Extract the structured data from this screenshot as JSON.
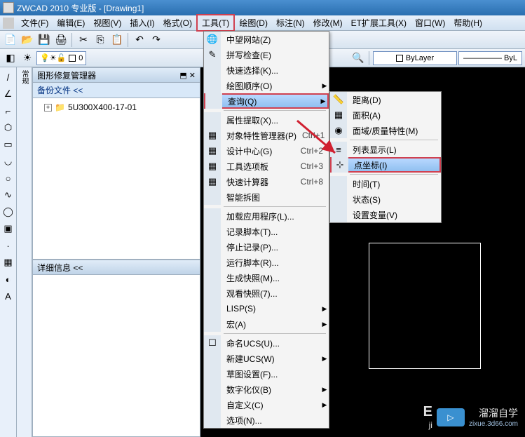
{
  "title": "ZWCAD 2010 专业版 - [Drawing1]",
  "menubar": {
    "items": [
      {
        "label": "文件(F)"
      },
      {
        "label": "编辑(E)"
      },
      {
        "label": "视图(V)"
      },
      {
        "label": "插入(I)"
      },
      {
        "label": "格式(O)"
      },
      {
        "label": "工具(T)",
        "active": true
      },
      {
        "label": "绘图(D)"
      },
      {
        "label": "标注(N)"
      },
      {
        "label": "修改(M)"
      },
      {
        "label": "ET扩展工具(X)"
      },
      {
        "label": "窗口(W)"
      },
      {
        "label": "帮助(H)"
      }
    ]
  },
  "toolbar1": {
    "zero": "0",
    "bylayer": "ByLayer",
    "bylayer2": "ByL"
  },
  "panel1": {
    "title": "图形修复管理器",
    "sub": "备份文件 <<",
    "tree_item": "5U300X400-17-01"
  },
  "panel2": {
    "title": "详细信息 <<"
  },
  "tools_menu": [
    {
      "icon": "🌐",
      "label": "中望网站(Z)"
    },
    {
      "icon": "✎",
      "label": "拼写检查(E)"
    },
    {
      "icon": "",
      "label": "快速选择(K)...",
      "boxed": false
    },
    {
      "icon": "",
      "label": "绘图顺序(O)",
      "arrow": true
    },
    {
      "icon": "",
      "label": "查询(Q)",
      "arrow": true,
      "hl": true,
      "boxed": true
    },
    {
      "sep": true
    },
    {
      "icon": "",
      "label": "属性提取(X)..."
    },
    {
      "icon": "▦",
      "label": "对象特性管理器(P)",
      "short": "Ctrl+1"
    },
    {
      "icon": "▦",
      "label": "设计中心(G)",
      "short": "Ctrl+2"
    },
    {
      "icon": "▦",
      "label": "工具选项板",
      "short": "Ctrl+3"
    },
    {
      "icon": "▦",
      "label": "快速计算器",
      "short": "Ctrl+8"
    },
    {
      "icon": "",
      "label": "智能拆图"
    },
    {
      "sep": true
    },
    {
      "icon": "",
      "label": "加载应用程序(L)..."
    },
    {
      "icon": "",
      "label": "记录脚本(T)..."
    },
    {
      "icon": "",
      "label": "停止记录(P)..."
    },
    {
      "icon": "",
      "label": "运行脚本(R)..."
    },
    {
      "icon": "",
      "label": "生成快照(M)..."
    },
    {
      "icon": "",
      "label": "观看快照(7)..."
    },
    {
      "icon": "",
      "label": "LISP(S)",
      "arrow": true
    },
    {
      "icon": "",
      "label": "宏(A)",
      "arrow": true
    },
    {
      "sep": true
    },
    {
      "icon": "☐",
      "label": "命名UCS(U)..."
    },
    {
      "icon": "",
      "label": "新建UCS(W)",
      "arrow": true
    },
    {
      "icon": "",
      "label": "草图设置(F)..."
    },
    {
      "icon": "",
      "label": "数字化仪(B)",
      "arrow": true
    },
    {
      "icon": "",
      "label": "自定义(C)",
      "arrow": true
    },
    {
      "icon": "",
      "label": "选项(N)..."
    }
  ],
  "query_menu": [
    {
      "icon": "📏",
      "label": "距离(D)"
    },
    {
      "icon": "▦",
      "label": "面积(A)"
    },
    {
      "icon": "◉",
      "label": "面域/质量特性(M)"
    },
    {
      "sep": true
    },
    {
      "icon": "≡",
      "label": "列表显示(L)"
    },
    {
      "icon": "⊹",
      "label": "点坐标(I)",
      "hl": true,
      "boxed": true
    },
    {
      "sep": true
    },
    {
      "icon": "",
      "label": "时间(T)"
    },
    {
      "icon": "",
      "label": "状态(S)"
    },
    {
      "icon": "",
      "label": "设置变量(V)"
    }
  ],
  "watermark": {
    "brand": "溜溜自学",
    "url": "zixue.3d66.com",
    "sub": "ji"
  }
}
